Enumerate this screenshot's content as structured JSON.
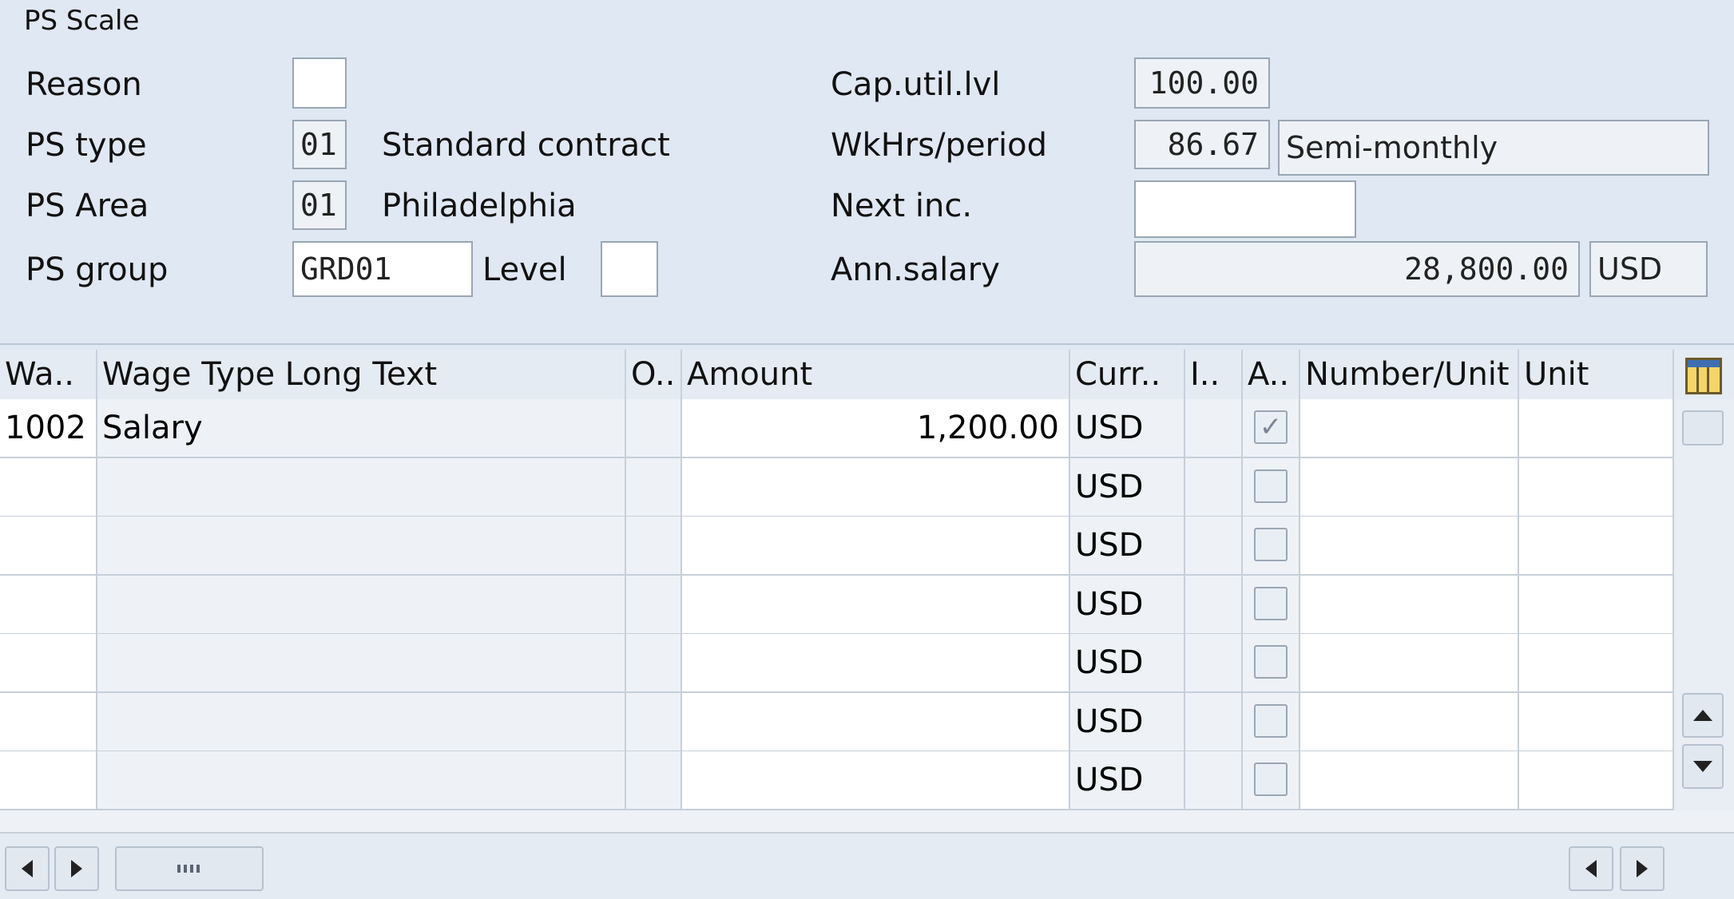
{
  "header": {
    "title": "PS Scale",
    "fields": {
      "reason_label": "Reason",
      "reason_value": "",
      "ps_type_label": "PS type",
      "ps_type_value": "01",
      "ps_type_text": "Standard contract",
      "ps_area_label": "PS Area",
      "ps_area_value": "01",
      "ps_area_text": "Philadelphia",
      "ps_group_label": "PS group",
      "ps_group_value": "GRD01",
      "level_label": "Level",
      "level_value": "",
      "cap_util_label": "Cap.util.lvl",
      "cap_util_value": "100.00",
      "wkhrs_label": "WkHrs/period",
      "wkhrs_value": "86.67",
      "wkhrs_period_text": "Semi-monthly",
      "next_inc_label": "Next inc.",
      "next_inc_value": "",
      "ann_salary_label": "Ann.salary",
      "ann_salary_value": "28,800.00",
      "ann_salary_currency": "USD"
    }
  },
  "table": {
    "columns": [
      "Wa..",
      "Wage Type Long Text",
      "O..",
      "Amount",
      "Curr..",
      "I..",
      "A..",
      "Number/Unit",
      "Unit"
    ],
    "rows": [
      {
        "wage_type": "1002",
        "long_text": "Salary",
        "op": "",
        "amount": "1,200.00",
        "currency": "USD",
        "ind": "",
        "assign": true,
        "number": "",
        "unit": ""
      },
      {
        "wage_type": "",
        "long_text": "",
        "op": "",
        "amount": "",
        "currency": "USD",
        "ind": "",
        "assign": false,
        "number": "",
        "unit": ""
      },
      {
        "wage_type": "",
        "long_text": "",
        "op": "",
        "amount": "",
        "currency": "USD",
        "ind": "",
        "assign": false,
        "number": "",
        "unit": ""
      },
      {
        "wage_type": "",
        "long_text": "",
        "op": "",
        "amount": "",
        "currency": "USD",
        "ind": "",
        "assign": false,
        "number": "",
        "unit": ""
      },
      {
        "wage_type": "",
        "long_text": "",
        "op": "",
        "amount": "",
        "currency": "USD",
        "ind": "",
        "assign": false,
        "number": "",
        "unit": ""
      },
      {
        "wage_type": "",
        "long_text": "",
        "op": "",
        "amount": "",
        "currency": "USD",
        "ind": "",
        "assign": false,
        "number": "",
        "unit": ""
      },
      {
        "wage_type": "",
        "long_text": "",
        "op": "",
        "amount": "",
        "currency": "USD",
        "ind": "",
        "assign": false,
        "number": "",
        "unit": ""
      }
    ]
  },
  "icons": {
    "column_config": "table-settings-icon",
    "scroll_up": "arrow-up-icon",
    "scroll_down": "arrow-down-icon",
    "scroll_left": "arrow-left-icon",
    "scroll_right": "arrow-right-icon",
    "hscroll_thumb": "scroll-thumb-icon"
  },
  "colors": {
    "panel_bg": "#dfe8f3",
    "field_border": "#9aa6b4",
    "field_bg": "#ffffff",
    "table_bg": "#eef2f7"
  }
}
